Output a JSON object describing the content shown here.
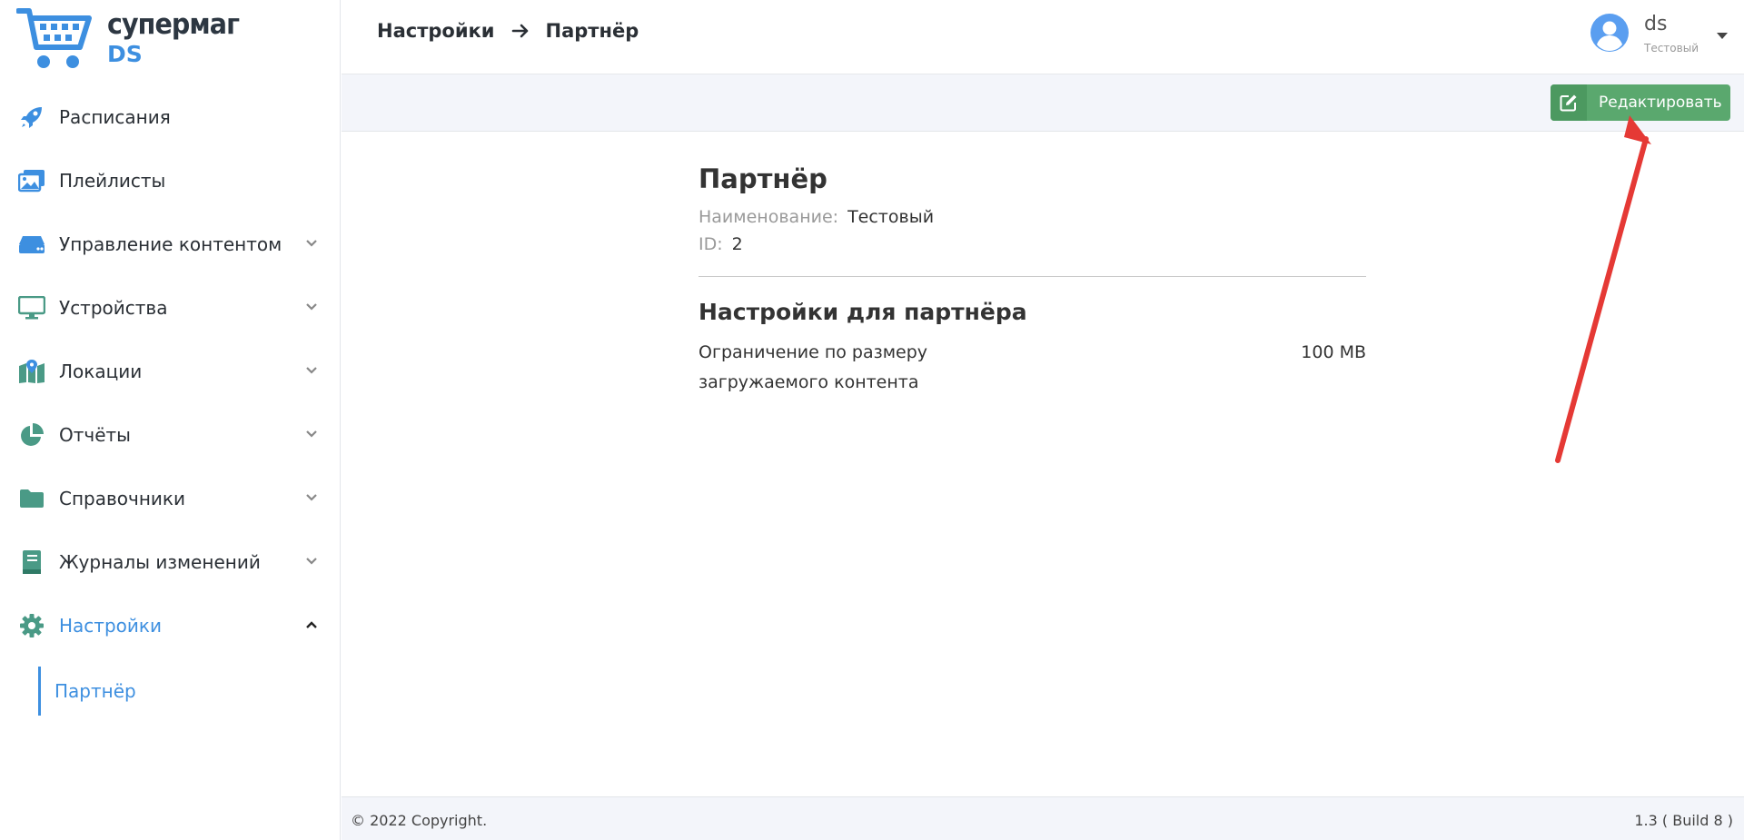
{
  "brand": {
    "name": "супермаг",
    "sub": "DS"
  },
  "sidebar": {
    "items": [
      {
        "label": "Расписания",
        "icon": "rocket-icon",
        "expandable": false
      },
      {
        "label": "Плейлисты",
        "icon": "images-icon",
        "expandable": false
      },
      {
        "label": "Управление контентом",
        "icon": "hdd-icon",
        "expandable": true
      },
      {
        "label": "Устройства",
        "icon": "monitor-icon",
        "expandable": true
      },
      {
        "label": "Локации",
        "icon": "map-icon",
        "expandable": true
      },
      {
        "label": "Отчёты",
        "icon": "pie-chart-icon",
        "expandable": true
      },
      {
        "label": "Справочники",
        "icon": "folder-icon",
        "expandable": true
      },
      {
        "label": "Журналы изменений",
        "icon": "book-icon",
        "expandable": true
      },
      {
        "label": "Настройки",
        "icon": "gear-icon",
        "expandable": true,
        "active": true
      }
    ],
    "subitems": [
      {
        "label": "Партнёр",
        "active": true
      }
    ]
  },
  "header": {
    "breadcrumb": [
      "Настройки",
      "Партнёр"
    ],
    "user": {
      "name": "ds",
      "org": "Тестовый"
    }
  },
  "toolbar": {
    "edit_label": "Редактировать"
  },
  "main": {
    "title": "Партнёр",
    "fields": [
      {
        "key": "Наименование:",
        "value": "Тестовый"
      },
      {
        "key": "ID:",
        "value": "2"
      }
    ],
    "settings_title": "Настройки для партнёра",
    "settings": [
      {
        "key": "Ограничение по размеру загружаемого контента",
        "value": "100 MB"
      }
    ]
  },
  "footer": {
    "copyright": "© 2022 Copyright.",
    "build": "1.3 ( Build 8 )"
  },
  "colors": {
    "accent": "#3d8fe0",
    "icon_green": "#4a9a86",
    "edit_button": "#5aa86e",
    "annotation": "#e53935"
  }
}
